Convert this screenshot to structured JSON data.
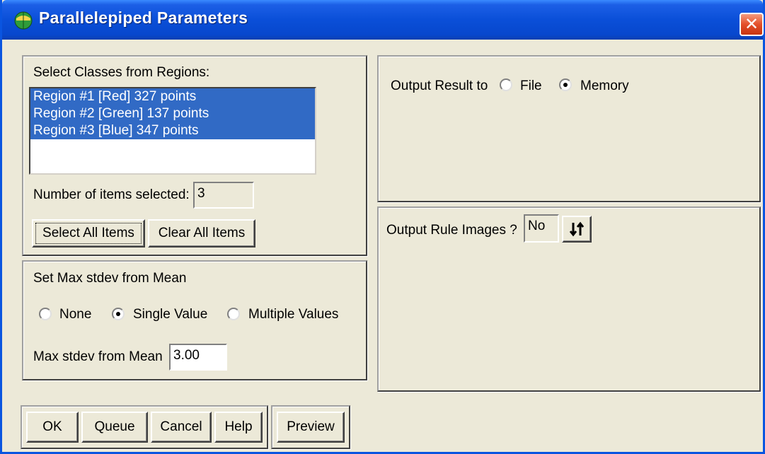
{
  "window": {
    "title": "Parallelepiped Parameters",
    "close_glyph": "✕",
    "icon": "globe-icon"
  },
  "classes": {
    "heading": "Select Classes from Regions:",
    "regions": [
      "Region #1 [Red] 327 points",
      "Region #2 [Green] 137 points",
      "Region #3 [Blue] 347 points"
    ],
    "items_selected_label": "Number of items selected:",
    "items_selected_value": "3",
    "select_all_label": "Select All Items",
    "clear_all_label": "Clear All Items"
  },
  "stdev": {
    "heading": "Set Max stdev from Mean",
    "options": [
      "None",
      "Single Value",
      "Multiple Values"
    ],
    "selected_option": "Single Value",
    "max_label": "Max stdev from Mean",
    "max_value": "3.00"
  },
  "output": {
    "result_label": "Output Result to",
    "options": [
      "File",
      "Memory"
    ],
    "selected_option": "Memory",
    "rule_images_label": "Output Rule Images ?",
    "rule_images_value": "No",
    "toggle_icon": "sort-arrows-icon"
  },
  "buttons": {
    "ok": "OK",
    "queue": "Queue",
    "cancel": "Cancel",
    "help": "Help",
    "preview": "Preview"
  },
  "colors": {
    "title_bar": "#0a4fd8",
    "selection": "#316ac5",
    "dialog_bg": "#ece9d8",
    "close": "#e4502a"
  }
}
